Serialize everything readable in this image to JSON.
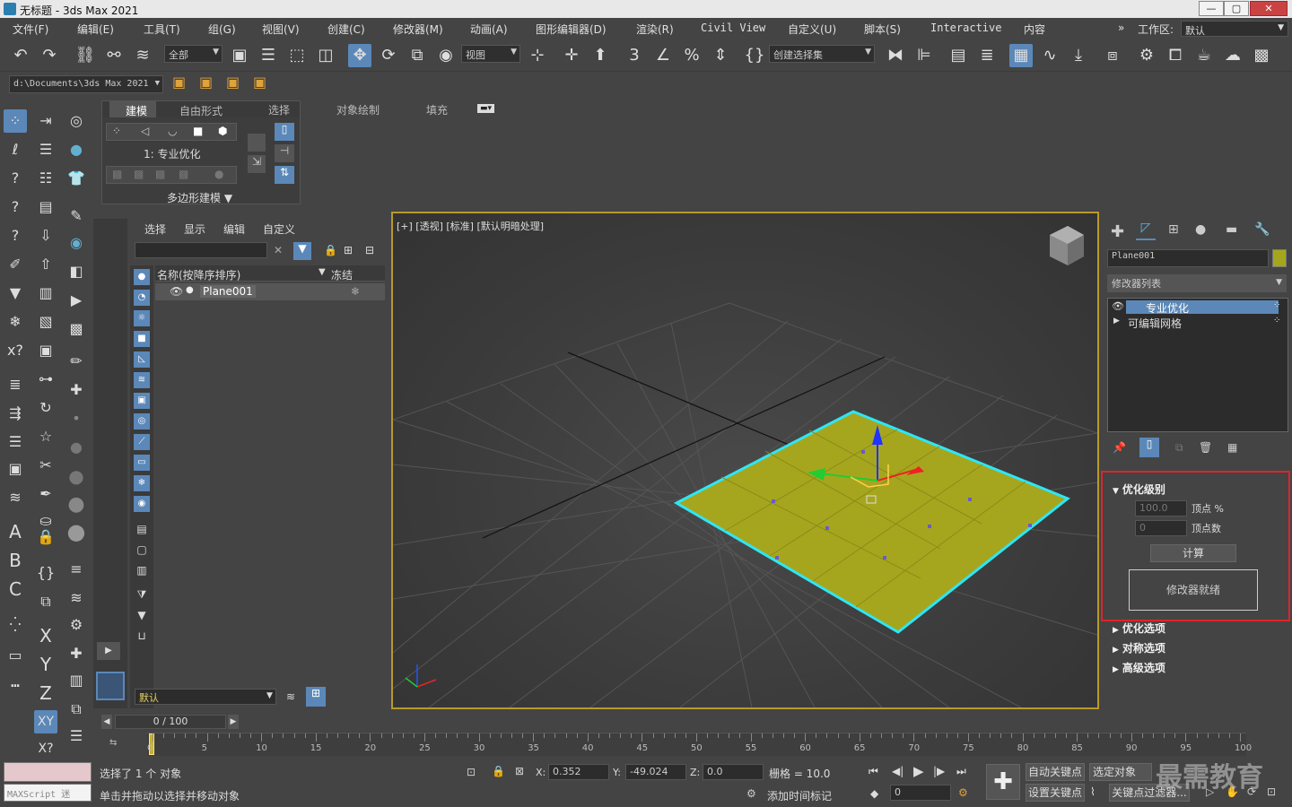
{
  "window": {
    "title": "无标题 - 3ds Max 2021",
    "minimize": "—",
    "maximize": "▢",
    "close": "✕"
  },
  "menu": [
    "文件(F)",
    "编辑(E)",
    "工具(T)",
    "组(G)",
    "视图(V)",
    "创建(C)",
    "修改器(M)",
    "动画(A)",
    "图形编辑器(D)",
    "渲染(R)",
    "Civil View",
    "自定义(U)",
    "脚本(S)",
    "Interactive",
    "内容"
  ],
  "workspace": {
    "label": "工作区:",
    "value": "默认",
    "chevron": "»"
  },
  "toolbar": {
    "selection_filter": "全部",
    "ref_coord": "视图",
    "named_selection": "创建选择集"
  },
  "project_path": "d:\\Documents\\3ds Max 2021",
  "ribbon": {
    "tabs": [
      "建模",
      "自由形式",
      "选择",
      "对象绘制",
      "填充"
    ],
    "active_tab": "建模",
    "level_label": "1: 专业优化",
    "footer": "多边形建模"
  },
  "scene_explorer": {
    "tabs": [
      "选择",
      "显示",
      "编辑",
      "自定义"
    ],
    "search_placeholder": "",
    "col_name": "名称(按降序排序)",
    "col_freeze": "冻结",
    "rows": [
      {
        "name": "Plane001"
      }
    ],
    "layer": "默认"
  },
  "viewport": {
    "label": "[+] [透视] [标准] [默认明暗处理]",
    "colors": {
      "plane": "#a6a61e",
      "selection": "#2ee6f5",
      "frame": "#b79a2a"
    }
  },
  "command_panel": {
    "object_name": "Plane001",
    "modifier_list": "修改器列表",
    "stack": [
      "专业优化",
      "可编辑网格"
    ],
    "rollouts": {
      "optimize_level": "优化级别",
      "vertex_pct_value": "100.0",
      "vertex_pct_label": "顶点 %",
      "vertex_count_value": "0",
      "vertex_count_label": "顶点数",
      "calculate": "计算",
      "status": "修改器就绪",
      "optimize_options": "优化选项",
      "symmetry_options": "对称选项",
      "advanced_options": "高级选项"
    }
  },
  "timeline": {
    "frame": "0 / 100",
    "ticks": [
      "0",
      "5",
      "10",
      "15",
      "20",
      "25",
      "30",
      "35",
      "40",
      "45",
      "50",
      "55",
      "60",
      "65",
      "70",
      "75",
      "80",
      "85",
      "90",
      "95",
      "100"
    ]
  },
  "status": {
    "maxscript": "MAXScript 迷",
    "selected": "选择了 1 个 对象",
    "hint": "单击并拖动以选择并移动对象",
    "x_label": "X:",
    "x": "0.352",
    "y_label": "Y:",
    "y": "-49.024",
    "z_label": "Z:",
    "z": "0.0",
    "grid": "栅格 = 10.0",
    "add_time_tag": "添加时间标记",
    "auto_key": "自动关键点",
    "selected_objects": "选定对象",
    "set_key": "设置关键点",
    "key_filters": "关键点过滤器...",
    "frame_field": "0",
    "watermark": "最需教育"
  }
}
